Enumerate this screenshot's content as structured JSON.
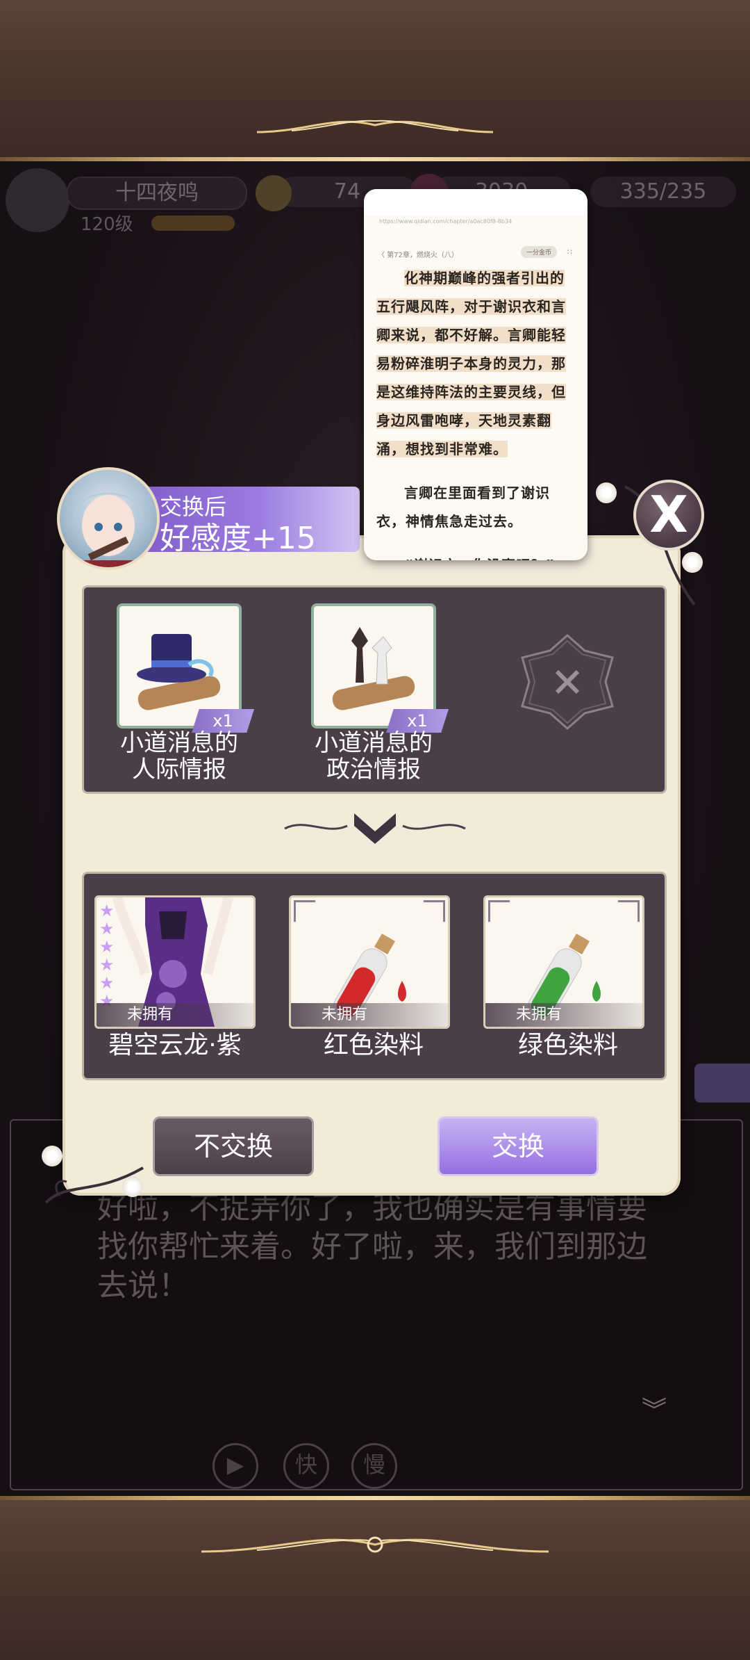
{
  "hud": {
    "player_name": "十四夜鸣",
    "level": "120级",
    "coins": "74",
    "gems": "3030",
    "stamina": "335/235"
  },
  "reader": {
    "url": "https://www.qidian.com/chapter/a0ac80f8-8b34",
    "chapter": "〈 第72章，燃烧火（八）",
    "coins": "一分金币",
    "grid_icon": "grid-icon",
    "paragraphs": [
      "化神期巅峰的强者引出的五行飓风阵，对于谢识衣和言卿来说，都不好解。言卿能轻易粉碎淮明子本身的灵力，那是这维持阵法的主要灵线，但身边风雷咆哮，天地灵素翻涌，想找到非常难。",
      "言卿在里面看到了谢识衣，神情焦急走过去。",
      "“谢识衣，你没事吧？”"
    ]
  },
  "exchange": {
    "header_sub": "交换后",
    "header_main": "好感度+15",
    "close_label": "X",
    "give_items": [
      {
        "label_line1": "小道消息的",
        "label_line2": "人际情报",
        "qty": "x1",
        "icon": "top-hat-scroll-icon"
      },
      {
        "label_line1": "小道消息的",
        "label_line2": "政治情报",
        "qty": "x1",
        "icon": "chess-scroll-icon"
      }
    ],
    "empty_slot_icon": "empty-slot-icon",
    "rewards": [
      {
        "label": "碧空云龙·紫",
        "status": "未拥有",
        "icon": "purple-dress-icon",
        "stars": 6
      },
      {
        "label": "红色染料",
        "status": "未拥有",
        "icon": "red-potion-icon"
      },
      {
        "label": "绿色染料",
        "status": "未拥有",
        "icon": "green-potion-icon"
      }
    ],
    "cancel_label": "不交换",
    "confirm_label": "交换"
  },
  "dialogue": {
    "text": "好啦，不捉弄你了，我也确实是有事情要找你帮忙来着。好了啦，来，我们到那边去说！",
    "play_label": "▶",
    "fast_label": "快",
    "slow_label": "慢"
  },
  "colors": {
    "accent_purple": "#9470e0",
    "panel_dark": "#4a3f48",
    "modal_bg": "#f3ebda"
  }
}
